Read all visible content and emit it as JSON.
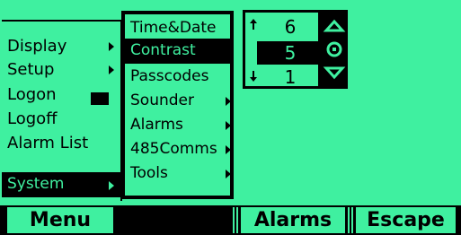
{
  "menu": {
    "items": [
      {
        "label": "Display",
        "submenu": true
      },
      {
        "label": "Setup",
        "submenu": true
      },
      {
        "label": "Logon",
        "submenu": false
      },
      {
        "label": "Logoff",
        "submenu": false
      },
      {
        "label": "Alarm List",
        "submenu": false
      }
    ],
    "selected": {
      "label": "System",
      "submenu": true
    }
  },
  "submenu": {
    "items": [
      {
        "label": "Time&Date",
        "submenu": false
      },
      {
        "label": "Contrast",
        "submenu": false,
        "selected": true
      },
      {
        "label": "Passcodes",
        "submenu": false
      },
      {
        "label": "Sounder",
        "submenu": true
      },
      {
        "label": "Alarms",
        "submenu": true
      },
      {
        "label": "485Comms",
        "submenu": true
      },
      {
        "label": "Tools",
        "submenu": true
      }
    ]
  },
  "spinner": {
    "above": "6",
    "current": "5",
    "below": "1"
  },
  "softkeys": {
    "menu": "Menu",
    "blank": "",
    "alarms": "Alarms",
    "escape": "Escape"
  },
  "colors": {
    "background": "#3ff0a0",
    "foreground": "#000000"
  }
}
